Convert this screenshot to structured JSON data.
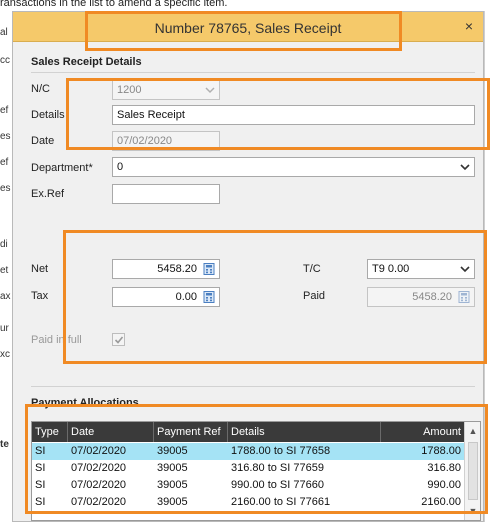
{
  "background": {
    "top_text": "ransactions in the list to amend a specific item.",
    "left_fragments": [
      "al",
      "cc",
      "ef",
      "es",
      "ef",
      "es",
      "di",
      "et",
      "ax",
      "ur",
      "xc",
      "te"
    ]
  },
  "dialog": {
    "title": "Number 78765, Sales Receipt",
    "close_label": "×"
  },
  "details": {
    "section_title": "Sales Receipt Details",
    "nc_label": "N/C",
    "nc_value": "1200",
    "details_label": "Details",
    "details_value": "Sales Receipt",
    "date_label": "Date",
    "date_value": "07/02/2020",
    "department_label": "Department*",
    "department_value": "0",
    "exref_label": "Ex.Ref",
    "exref_value": ""
  },
  "amounts": {
    "net_label": "Net",
    "net_value": "5458.20",
    "tax_label": "Tax",
    "tax_value": "0.00",
    "tc_label": "T/C",
    "tc_value": "T9  0.00",
    "paid_label": "Paid",
    "paid_value": "5458.20",
    "paid_in_full_label": "Paid in full",
    "paid_in_full_checked": true
  },
  "allocations": {
    "section_title": "Payment Allocations",
    "columns": [
      "Type",
      "Date",
      "Payment Ref",
      "Details",
      "Amount"
    ],
    "rows": [
      {
        "type": "SI",
        "date": "07/02/2020",
        "ref": "39005",
        "details": "1788.00 to SI 77658",
        "amount": "1788.00"
      },
      {
        "type": "SI",
        "date": "07/02/2020",
        "ref": "39005",
        "details": "316.80 to SI 77659",
        "amount": "316.80"
      },
      {
        "type": "SI",
        "date": "07/02/2020",
        "ref": "39005",
        "details": "990.00 to SI 77660",
        "amount": "990.00"
      },
      {
        "type": "SI",
        "date": "07/02/2020",
        "ref": "39005",
        "details": "2160.00 to SI 77661",
        "amount": "2160.00"
      }
    ]
  },
  "colors": {
    "title_bar": "#f5c96a",
    "highlight": "#f08a24",
    "selected_row": "#a5e3f5",
    "table_header": "#3a3a3a"
  }
}
